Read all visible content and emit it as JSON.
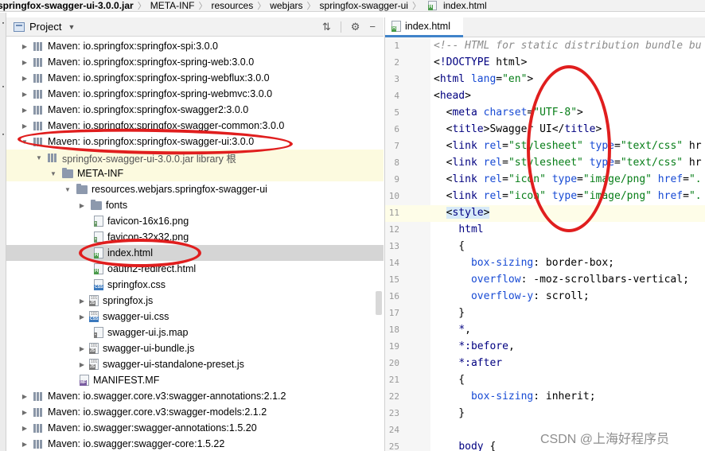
{
  "breadcrumb": {
    "items": [
      "springfox-swagger-ui-3.0.0.jar",
      "META-INF",
      "resources",
      "webjars",
      "springfox-swagger-ui"
    ],
    "file": "index.html"
  },
  "project_panel": {
    "title": "Project",
    "tree": [
      {
        "label": "Maven: io.springfox:springfox-spi:3.0.0"
      },
      {
        "label": "Maven: io.springfox:springfox-spring-web:3.0.0"
      },
      {
        "label": "Maven: io.springfox:springfox-spring-webflux:3.0.0"
      },
      {
        "label": "Maven: io.springfox:springfox-spring-webmvc:3.0.0"
      },
      {
        "label": "Maven: io.springfox:springfox-swagger2:3.0.0"
      },
      {
        "label": "Maven: io.springfox:springfox-swagger-common:3.0.0"
      },
      {
        "label": "Maven: io.springfox:springfox-swagger-ui:3.0.0"
      },
      {
        "label": "springfox-swagger-ui-3.0.0.jar  library 根"
      },
      {
        "label": "META-INF"
      },
      {
        "label": "resources.webjars.springfox-swagger-ui"
      },
      {
        "label": "fonts"
      },
      {
        "label": "favicon-16x16.png"
      },
      {
        "label": "favicon-32x32.png"
      },
      {
        "label": "index.html"
      },
      {
        "label": "oauth2-redirect.html"
      },
      {
        "label": "springfox.css"
      },
      {
        "label": "springfox.js"
      },
      {
        "label": "swagger-ui.css"
      },
      {
        "label": "swagger-ui.js.map"
      },
      {
        "label": "swagger-ui-bundle.js"
      },
      {
        "label": "swagger-ui-standalone-preset.js"
      },
      {
        "label": "MANIFEST.MF"
      },
      {
        "label": "Maven: io.swagger.core.v3:swagger-annotations:2.1.2"
      },
      {
        "label": "Maven: io.swagger.core.v3:swagger-models:2.1.2"
      },
      {
        "label": "Maven: io.swagger:swagger-annotations:1.5.20"
      },
      {
        "label": "Maven: io.swagger:swagger-core:1.5.22"
      }
    ]
  },
  "editor": {
    "tab_label": "index.html",
    "line_numbers": [
      "1",
      "2",
      "3",
      "4",
      "5",
      "6",
      "7",
      "8",
      "9",
      "10",
      "11",
      "12",
      "13",
      "14",
      "15",
      "16",
      "17",
      "18",
      "19",
      "20",
      "21",
      "22",
      "23",
      "24",
      "25"
    ],
    "lines": [
      "<!-- HTML for static distribution bundle bu",
      "<!DOCTYPE html>",
      "<html lang=\"en\">",
      "<head>",
      "  <meta charset=\"UTF-8\">",
      "  <title>Swagger UI</title>",
      "  <link rel=\"stylesheet\" type=\"text/css\" hr",
      "  <link rel=\"stylesheet\" type=\"text/css\" hr",
      "  <link rel=\"icon\" type=\"image/png\" href=\".",
      "  <link rel=\"icon\" type=\"image/png\" href=\".",
      "  <style>",
      "    html",
      "    {",
      "      box-sizing: border-box;",
      "      overflow: -moz-scrollbars-vertical;",
      "      overflow-y: scroll;",
      "    }",
      "    *,",
      "    *:before,",
      "    *:after",
      "    {",
      "      box-sizing: inherit;",
      "    }",
      "",
      "    body {"
    ]
  },
  "watermark": "CSDN @上海好程序员"
}
